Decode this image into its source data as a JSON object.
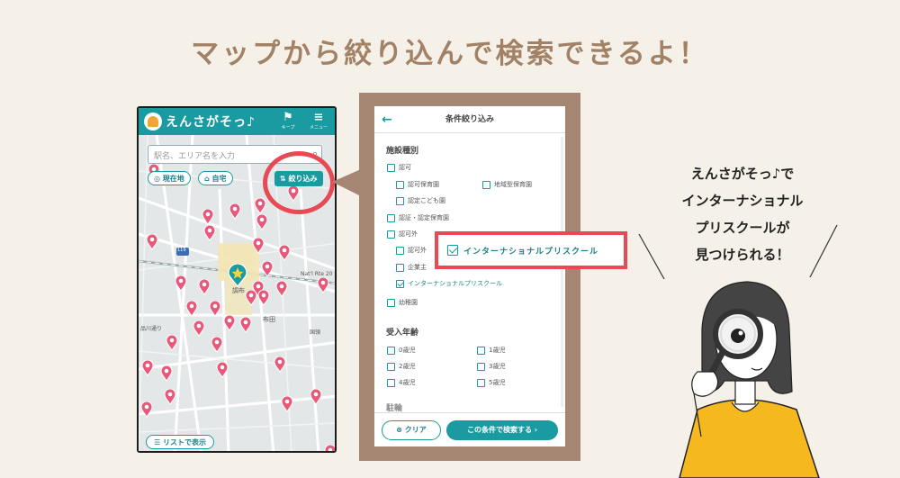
{
  "headline": "マップから絞り込んで検索できるよ！",
  "app": {
    "logo_text": "えんさがそっ♪",
    "keep_label": "キープ",
    "menu_label": "メニュー",
    "search_placeholder": "駅名、エリア名を入力",
    "current_location": "現在地",
    "home": "自宅",
    "filter_button": "絞り込み",
    "list_button": "リストで表示",
    "map_labels": {
      "station": "調布",
      "fuda": "布田",
      "route20": "Nat'l Rte 20",
      "route119": "119",
      "shinagawa": "品川通り",
      "kokuryo": "国領"
    }
  },
  "filter_screen": {
    "title": "条件絞り込み",
    "facility_section": "施設種別",
    "facility": {
      "ninka": "認可",
      "ninka_hoikuen": "認可保育園",
      "chiiki": "地域型保育園",
      "nintei": "認定こども園",
      "ninsho": "認証・認定保育園",
      "ninkagai": "認可外",
      "ninkagai_child": "認可外",
      "kigyo": "企業主",
      "international": "インターナショナルプリスクール",
      "yochien": "幼稚園"
    },
    "age_section": "受入年齢",
    "ages": [
      "0歳児",
      "1歳児",
      "2歳児",
      "3歳児",
      "4歳児",
      "5歳児"
    ],
    "next_section": "駐輪",
    "clear_button": "クリア",
    "search_button": "この条件で検索する"
  },
  "highlight_label": "インターナショナルプリスクール",
  "caption": [
    "えんさがそっ♪で",
    "インターナショナル",
    "プリスクールが",
    "見つけられる！"
  ],
  "colors": {
    "teal": "#1a9aa1",
    "pin": "#e8587a",
    "accent_red": "#e84a55",
    "headline_brown": "#a28266",
    "panel_brown": "#a58672",
    "background": "#f6f1e8"
  }
}
